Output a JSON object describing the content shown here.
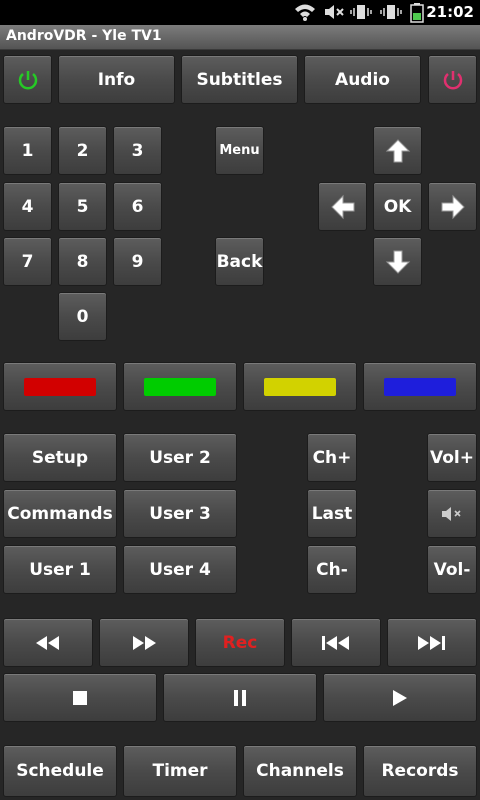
{
  "status": {
    "time": "21:02"
  },
  "app": {
    "title": "AndroVDR - Yle TV1"
  },
  "top": {
    "info": "Info",
    "subtitles": "Subtitles",
    "audio": "Audio"
  },
  "keypad": {
    "k1": "1",
    "k2": "2",
    "k3": "3",
    "k4": "4",
    "k5": "5",
    "k6": "6",
    "k7": "7",
    "k8": "8",
    "k9": "9",
    "k0": "0"
  },
  "nav": {
    "menu": "Menu",
    "back": "Back",
    "ok": "OK"
  },
  "colors": {
    "red": "#d20000",
    "green": "#00cc00",
    "yellow": "#d2d200",
    "blue": "#1e1edc",
    "power_on": "#26c926",
    "power_off": "#e0306f"
  },
  "functions": {
    "setup": "Setup",
    "commands": "Commands",
    "user1": "User 1",
    "user2": "User 2",
    "user3": "User 3",
    "user4": "User 4",
    "ch_up": "Ch+",
    "last": "Last",
    "ch_down": "Ch-",
    "vol_up": "Vol+",
    "vol_down": "Vol-"
  },
  "transport": {
    "rec": "Rec"
  },
  "bottom": {
    "schedule": "Schedule",
    "timer": "Timer",
    "channels": "Channels",
    "records": "Records"
  }
}
